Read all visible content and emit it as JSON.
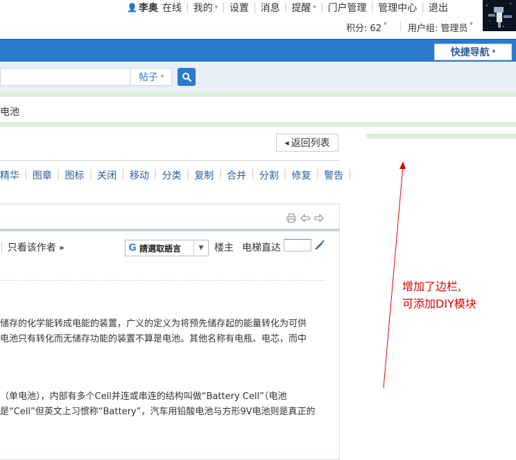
{
  "topbar": {
    "username": "李奥",
    "online": "在线",
    "links": [
      "我的",
      "设置",
      "消息",
      "提醒",
      "门户管理",
      "管理中心",
      "退出"
    ],
    "credits_label": "积分: 62",
    "usergroup_label": "用户组: 管理员"
  },
  "nav": {
    "quick_nav": "快捷导航"
  },
  "search": {
    "type": "帖子",
    "value": ""
  },
  "breadcrumb": "电池",
  "thread": {
    "back_to_list": "返回列表",
    "mod_actions": [
      "精华",
      "图章",
      "图标",
      "关闭",
      "移动",
      "分类",
      "复制",
      "合并",
      "分割",
      "修复",
      "警告"
    ],
    "only_author": "只看该作者",
    "translate_label": "請選取語言",
    "floor_label": "楼主",
    "elevator_label": "电梯直达",
    "paragraphs": [
      [
        "储存的化学能转成电能的装置，广义的定义为将预先储存起的能量转化为可供",
        "电池只有转化而无储存功能的装置不算是电池。其他名称有电瓶、电芯，而中"
      ],
      [
        "（单电池），内部有多个Cell并连或串连的结构叫做“Battery Cell”（电池",
        "是“Cell”但英文上习惯称“Battery”，汽车用铅酸电池与方形9V电池则是真正的"
      ]
    ]
  },
  "annotation": {
    "line1": "增加了边栏,",
    "line2": "可添加DIY模块"
  },
  "colors": {
    "nav_blue": "#2b7acd",
    "link_blue": "#2b5d96",
    "green_strip": "#dcefd9",
    "annotation_red": "#e00000"
  }
}
